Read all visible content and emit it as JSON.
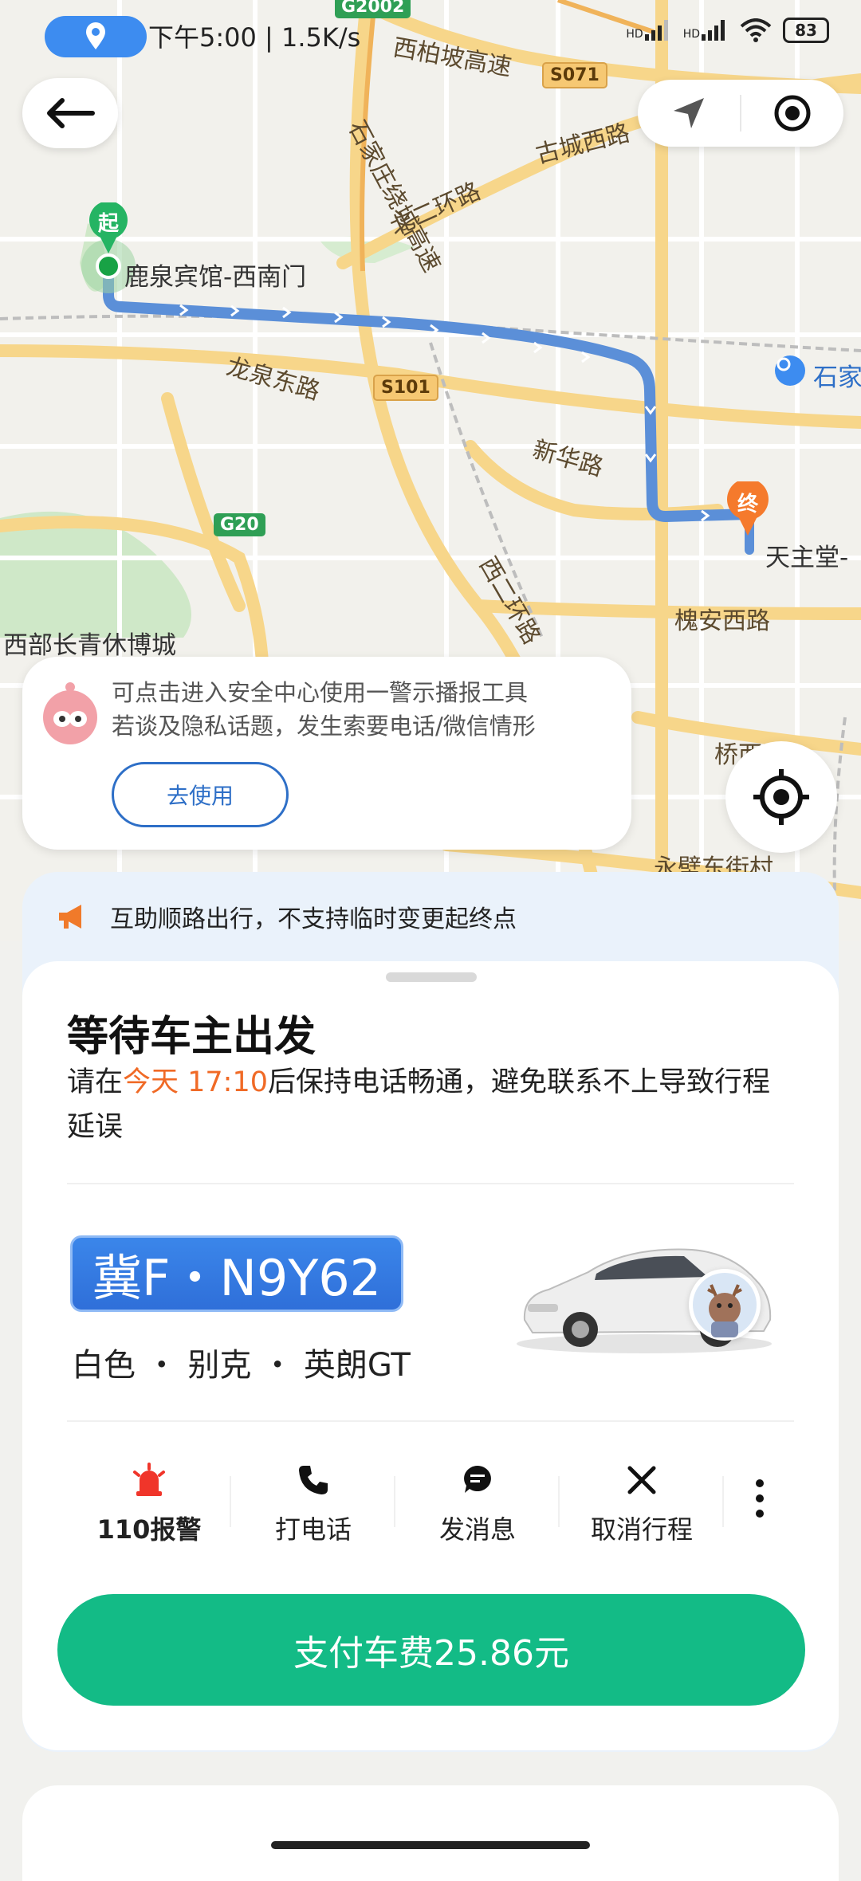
{
  "status_bar": {
    "time_speed": "下午5:00 | 1.5K/s",
    "battery": "83",
    "signal_1": "HD",
    "signal_2": "HD"
  },
  "map": {
    "roads": {
      "g2002": "G2002",
      "xibaipo": "西柏坡高速",
      "s071": "S071",
      "shijiazhuang_ring": "石家庄绕城高速",
      "gucheng": "古城西路",
      "north_ring": "北二环路",
      "longquan_east": "龙泉东路",
      "s101": "S101",
      "xinhua": "新华路",
      "g20": "G20",
      "west_ring": "西二环路",
      "huaian_west": "槐安西路",
      "qiaoxi": "桥西区",
      "yongbi": "永壁东街村"
    },
    "pois": {
      "start": "鹿泉宾馆-西南门",
      "end": "天主堂-",
      "park": "西部长青休博城",
      "station": "石家"
    },
    "start_badge": "起",
    "end_badge": "终"
  },
  "tip": {
    "line1": "可点击进入安全中心使用一警示播报工具",
    "line2": "若谈及隐私话题，发生索要电话/微信情形",
    "button": "去使用"
  },
  "notice": {
    "text": "互助顺路出行，不支持临时变更起终点"
  },
  "trip": {
    "title": "等待车主出发",
    "sub_prefix": "请在",
    "sub_time": "今天 17:10",
    "sub_suffix": "后保持电话畅通，避免联系不上导致行程延误",
    "plate": "冀F・N9Y62",
    "car_desc": "白色 ・ 别克 ・ 英朗GT"
  },
  "actions": [
    {
      "label": "110报警",
      "icon": "alarm-icon"
    },
    {
      "label": "打电话",
      "icon": "phone-icon"
    },
    {
      "label": "发消息",
      "icon": "message-icon"
    },
    {
      "label": "取消行程",
      "icon": "close-icon"
    }
  ],
  "pay_button": "支付车费25.86元",
  "colors": {
    "accent_green": "#13bb86",
    "route_blue": "#5b8fd8",
    "highlight_orange": "#f06a26",
    "plate_blue": "#2f6fd9"
  }
}
